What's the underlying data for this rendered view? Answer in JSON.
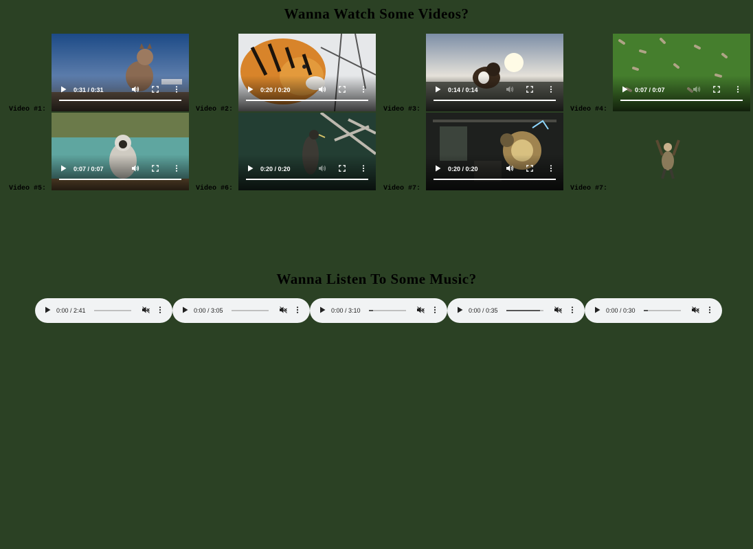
{
  "videos_title": "Wanna Watch Some Videos?",
  "music_title": "Wanna Listen To Some Music?",
  "videos": [
    {
      "label": "Video #1:",
      "time": "0:31 / 0:31",
      "scene": "cat walking at dusk",
      "controls": true
    },
    {
      "label": "Video #2:",
      "time": "0:20 / 0:20",
      "scene": "tiger close-up",
      "controls": true
    },
    {
      "label": "Video #3:",
      "time": "0:14 / 0:14",
      "scene": "dog on beach at sunset",
      "controls": true
    },
    {
      "label": "Video #4:",
      "time": "0:07 / 0:07",
      "scene": "grass field",
      "controls": true
    },
    {
      "label": "Video #5:",
      "time": "0:07 / 0:07",
      "scene": "monkey sitting by river",
      "controls": true
    },
    {
      "label": "Video #6:",
      "time": "0:20 / 0:20",
      "scene": "bird on branch",
      "controls": true
    },
    {
      "label": "Video #7:",
      "time": "0:20 / 0:20",
      "scene": "steampunk workshop",
      "controls": true
    },
    {
      "label": "Video #7:",
      "time": "",
      "scene": "person with raised arms",
      "controls": false
    }
  ],
  "audios": [
    {
      "time": "0:00 / 2:41",
      "volume": 0.0
    },
    {
      "time": "0:00 / 3:05",
      "volume": 0.0
    },
    {
      "time": "0:00 / 3:10",
      "volume": 0.12
    },
    {
      "time": "0:00 / 0:35",
      "volume": 0.9
    },
    {
      "time": "0:00 / 0:30",
      "volume": 0.12
    }
  ],
  "icons": {
    "play": "play-icon",
    "volume": "volume-icon",
    "muted": "muted-icon",
    "fullscreen": "fullscreen-icon",
    "more": "more-options-icon"
  },
  "colors": {
    "background": "#2b4124",
    "player": "#f1f3f4"
  }
}
